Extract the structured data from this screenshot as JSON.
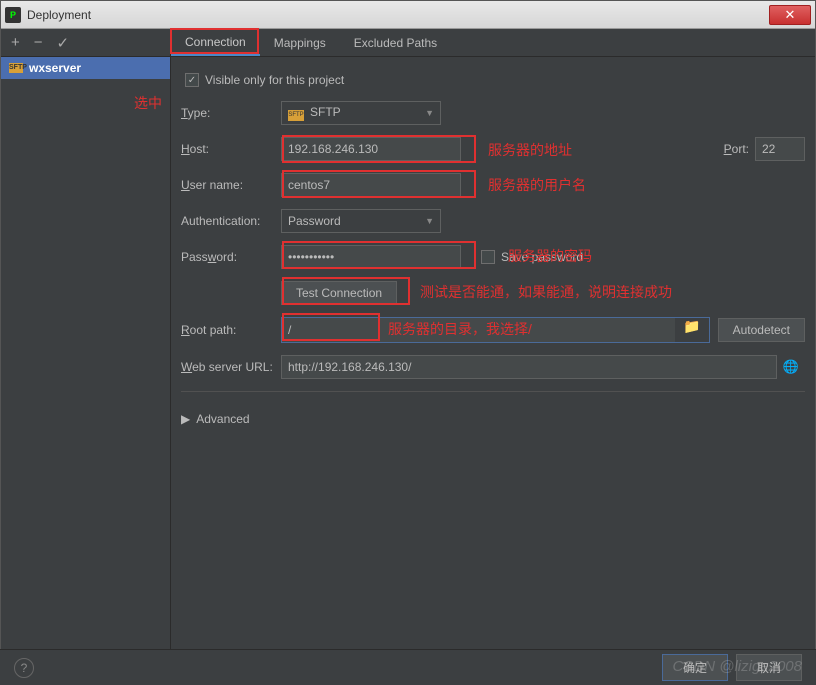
{
  "window": {
    "title": "Deployment"
  },
  "sidebar": {
    "server": {
      "name": "wxserver"
    }
  },
  "tabs": {
    "connection": "Connection",
    "mappings": "Mappings",
    "excluded": "Excluded Paths"
  },
  "form": {
    "visible_only_label": "Visible only for this project",
    "type_label": "Type:",
    "type_value": "SFTP",
    "host_label": "Host:",
    "host_value": "192.168.246.130",
    "port_label": "Port:",
    "port_value": "22",
    "username_label": "User name:",
    "username_value": "centos7",
    "auth_label": "Authentication:",
    "auth_value": "Password",
    "password_label": "Password:",
    "password_value": "•••••••••••",
    "save_password_label": "Save password",
    "test_connection_label": "Test Connection",
    "root_path_label": "Root path:",
    "root_path_value": "/",
    "autodetect_label": "Autodetect",
    "web_url_label": "Web server URL:",
    "web_url_value": "http://192.168.246.130/",
    "advanced_label": "Advanced"
  },
  "footer": {
    "ok": "确定",
    "cancel": "取消"
  },
  "annotations": {
    "selected": "选中",
    "host": "服务器的地址",
    "username": "服务器的用户名",
    "password": "服务器的密码",
    "test": "测试是否能通，如果能通，说明连接成功",
    "rootpath": "服务器的目录，我选择/"
  },
  "watermark": "CSDN @lizige2008"
}
